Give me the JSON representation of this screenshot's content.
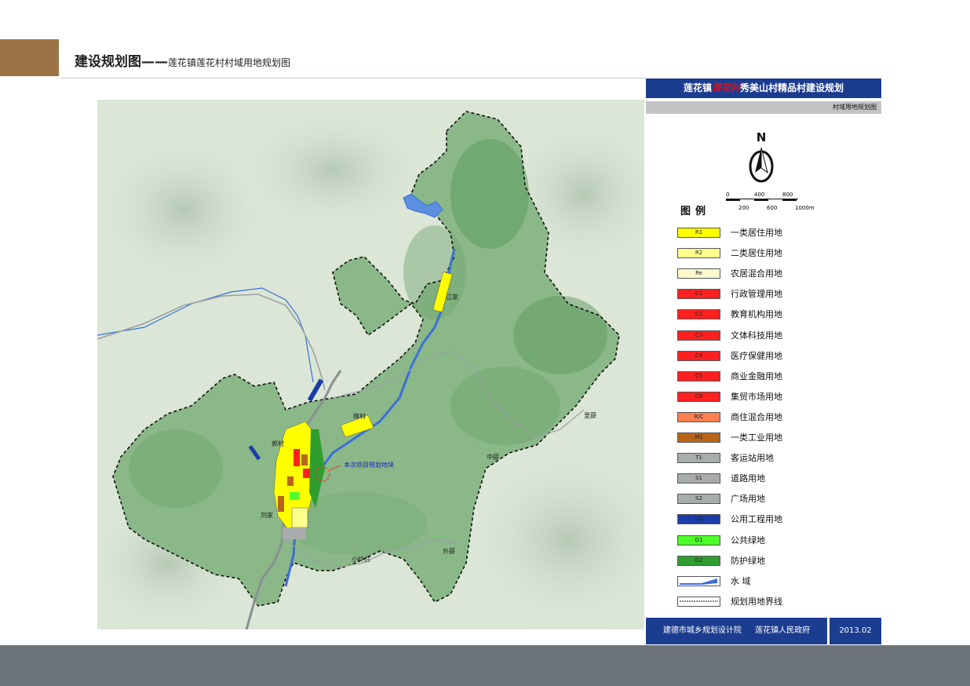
{
  "page": {
    "title": "建设规划图——",
    "subtitle": "莲花镇莲花村村域用地规划图"
  },
  "panel": {
    "header_prefix": "莲花镇",
    "header_highlight": "莲花村",
    "header_suffix": "秀美山村精品村建设规划",
    "subheader": "村域用地规划图",
    "north_label": "N",
    "scale_top": [
      "0",
      "400",
      "800"
    ],
    "scale_bottom": [
      "200",
      "600",
      "1000m"
    ],
    "legend_title": "图例",
    "legend": [
      {
        "code": "R1",
        "label": "一类居住用地",
        "color": "#ffff00"
      },
      {
        "code": "R2",
        "label": "二类居住用地",
        "color": "#ffff8c"
      },
      {
        "code": "Re",
        "label": "农居混合用地",
        "color": "#fffacd"
      },
      {
        "code": "C1",
        "label": "行政管理用地",
        "color": "#ff2020"
      },
      {
        "code": "C2",
        "label": "教育机构用地",
        "color": "#ff2020"
      },
      {
        "code": "C3",
        "label": "文体科技用地",
        "color": "#ff2020"
      },
      {
        "code": "C4",
        "label": "医疗保健用地",
        "color": "#ff2020"
      },
      {
        "code": "C5",
        "label": "商业金融用地",
        "color": "#ff2020"
      },
      {
        "code": "C6",
        "label": "集贸市场用地",
        "color": "#ff2020"
      },
      {
        "code": "R/C",
        "label": "商住混合用地",
        "color": "#ff7f50"
      },
      {
        "code": "M1",
        "label": "一类工业用地",
        "color": "#b8651b"
      },
      {
        "code": "T1",
        "label": "客运站用地",
        "color": "#a8acad"
      },
      {
        "code": "S1",
        "label": "道路用地",
        "color": "#a8acad"
      },
      {
        "code": "S2",
        "label": "广场用地",
        "color": "#a8acad"
      },
      {
        "code": "U1",
        "label": "公用工程用地",
        "color": "#1a3ea8"
      },
      {
        "code": "G1",
        "label": "公共绿地",
        "color": "#4cff28"
      },
      {
        "code": "G2",
        "label": "防护绿地",
        "color": "#2f9e2f"
      },
      {
        "code": "",
        "label": "水 域",
        "color": "#3d6fd8"
      },
      {
        "code": "",
        "label": "规划用地界线",
        "color": "#ffffff"
      }
    ],
    "footer_left": "建德市城乡规划设计院 莲花镇人民政府",
    "footer_right": "2013.02"
  },
  "map_labels": {
    "jiangbian": "江家",
    "zhangcun": "樟村",
    "guocun": "郭村",
    "liujia": "刘家",
    "lixue": "里薛",
    "zhongxue": "中薛",
    "xiaolinghou": "小岭后",
    "waixue": "外薛",
    "project_site": "本次项目规划地块"
  }
}
